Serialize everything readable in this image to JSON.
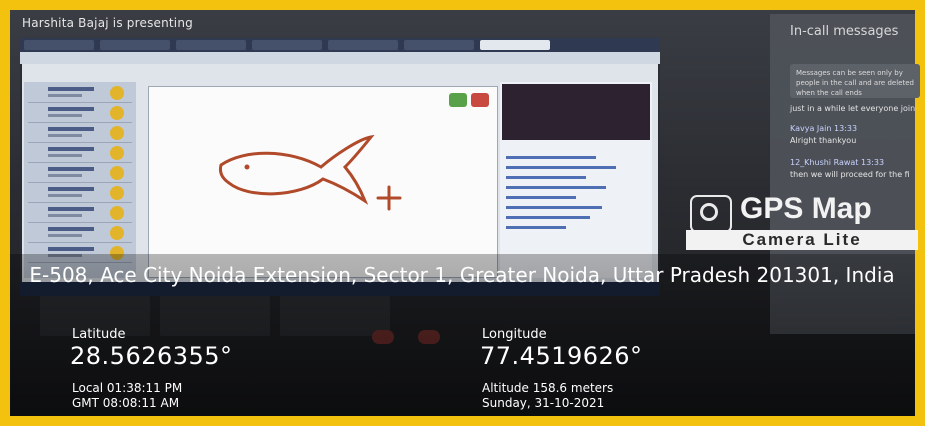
{
  "meet": {
    "presenting_text": "Harshita Bajaj is presenting",
    "incall_title": "In-call messages",
    "incall_note": "Messages can be seen only by people in the call and are deleted when the call ends",
    "messages": [
      {
        "text": "just in a while let everyone join"
      },
      {
        "text": "Kavya Jain  13:33"
      },
      {
        "text": "Alright thankyou"
      },
      {
        "text": "12_Khushi Rawat  13:33"
      },
      {
        "text": "then we will proceed for the fi"
      }
    ]
  },
  "gps": {
    "app_title": "GPS Map",
    "app_subtitle": "Camera Lite",
    "address": "E-508, Ace City Noida Extension, Sector 1, Greater Noida, Uttar Pradesh 201301, India",
    "latitude_label": "Latitude",
    "latitude_value": "28.5626355°",
    "longitude_label": "Longitude",
    "longitude_value": "77.4519626°",
    "local_time": "Local 01:38:11 PM",
    "gmt_time": "GMT 08:08:11 AM",
    "altitude": "Altitude 158.6 meters",
    "date": "Sunday, 31-10-2021"
  },
  "icons": {
    "logo": "camera-lens-icon",
    "thumbs_up": "thumbs-up-icon",
    "thumbs_down": "thumbs-down-icon"
  },
  "colors": {
    "frame": "#f3c20f",
    "overlay_text": "#ffffff",
    "drawing_stroke": "#b04a2a"
  }
}
